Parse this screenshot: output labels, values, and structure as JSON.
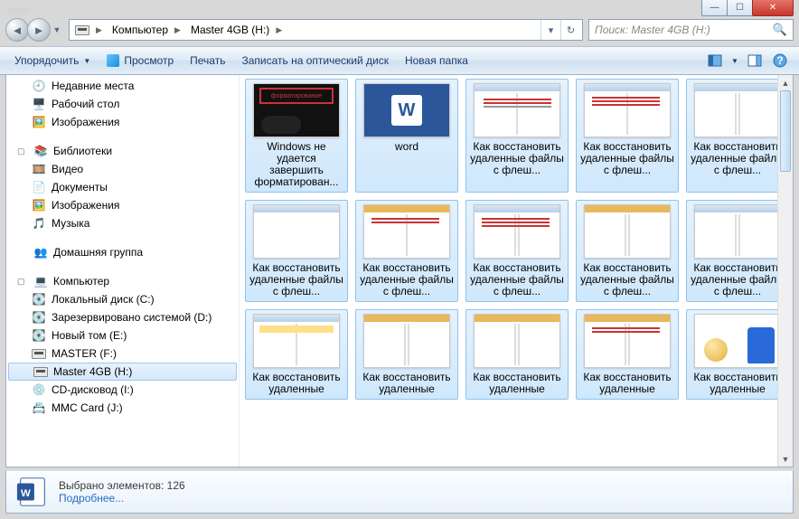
{
  "window": {
    "min_glyph": "—",
    "max_glyph": "☐",
    "close_glyph": "✕"
  },
  "address": {
    "root": "Компьютер",
    "drive": "Master 4GB (H:)"
  },
  "search": {
    "placeholder": "Поиск: Master 4GB (H:)"
  },
  "toolbar": {
    "organize": "Упорядочить",
    "preview": "Просмотр",
    "print": "Печать",
    "burn": "Записать на оптический диск",
    "newfolder": "Новая папка"
  },
  "sidebar": {
    "quick": {
      "recent": "Недавние места",
      "desktop": "Рабочий стол",
      "pictures": "Изображения"
    },
    "libraries": {
      "label": "Библиотеки",
      "video": "Видео",
      "docs": "Документы",
      "pics": "Изображения",
      "music": "Музыка"
    },
    "homegroup": "Домашняя группа",
    "computer": {
      "label": "Компьютер",
      "c": "Локальный диск (C:)",
      "d": "Зарезервировано системой (D:)",
      "e": "Новый том (E:)",
      "f": "MASTER (F:)",
      "h": "Master 4GB (H:)",
      "i": "CD-дисковод (I:)",
      "j": "MMC Card (J:)"
    }
  },
  "files": {
    "r1": [
      "Windows не удается завершить форматирован...",
      "word",
      "Как восстановить удаленные файлы с флеш...",
      "Как восстановить удаленные файлы с флеш...",
      "Как восстановить удаленные файлы с флеш..."
    ],
    "r2": [
      "Как восстановить удаленные файлы с флеш...",
      "Как восстановить удаленные файлы с флеш...",
      "Как восстановить удаленные файлы с флеш...",
      "Как восстановить удаленные файлы с флеш...",
      "Как восстановить удаленные файлы с флеш..."
    ],
    "r3": [
      "Как восстановить удаленные",
      "Как восстановить удаленные",
      "Как восстановить удаленные",
      "Как восстановить удаленные",
      "Как восстановить удаленные"
    ]
  },
  "status": {
    "line1": "Выбрано элементов: 126",
    "line2": "Подробнее..."
  }
}
